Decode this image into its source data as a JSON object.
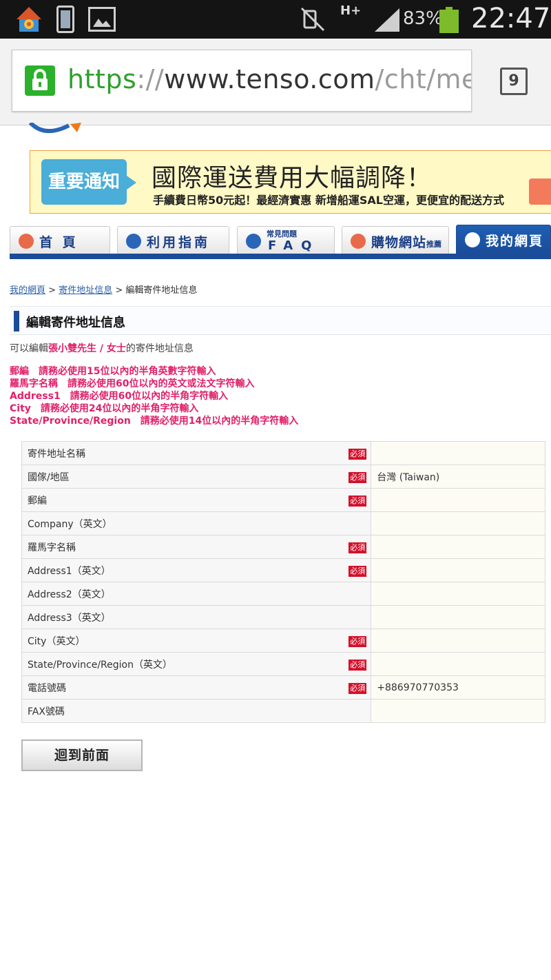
{
  "status_bar": {
    "network": "H+",
    "battery": "83%",
    "time": "22:47",
    "icons": [
      "home-app-icon",
      "phone-screen-icon",
      "gallery-icon",
      "mute-icon",
      "signal-icon",
      "battery-icon"
    ]
  },
  "browser": {
    "url_scheme": "https",
    "url_sep": "://",
    "url_host": "www.tenso.com",
    "url_path": "/cht/mem",
    "tab_count": "9"
  },
  "banner": {
    "tag": "重要通知",
    "title": "國際運送費用大幅調降！",
    "subtitle": "手續費日幣50元起！最經濟實惠  新增船運SAL空運，更便宜的配送方式"
  },
  "nav": {
    "home": "首 頁",
    "guide": "利用指南",
    "faq_small": "常見問題",
    "faq": "FAQ",
    "shopping": "購物網站",
    "shopping_small": "推薦",
    "mypage": "我的網頁"
  },
  "breadcrumb": {
    "crumb1": "我的網頁",
    "sep1": " > ",
    "crumb2": "寄件地址信息",
    "sep2": " > ",
    "current": "編輯寄件地址信息"
  },
  "page": {
    "title": "編輯寄件地址信息",
    "intro_prefix": "可以編輯",
    "intro_name": "張小雙先生 / 女士",
    "intro_suffix": "的寄件地址信息"
  },
  "rules": [
    "郵編　請務必使用15位以內的半角英數字符輸入",
    "羅馬字名稱　請務必使用60位以內的英文或法文字符輸入",
    "Address1　請務必使用60位以內的半角字符輸入",
    "City　請務必使用24位以內的半角字符輸入",
    "State/Province/Region　請務必使用14位以內的半角字符輸入"
  ],
  "required_label": "必須",
  "form_rows": [
    {
      "label": "寄件地址名稱",
      "required": true,
      "value": ""
    },
    {
      "label": "國傢/地區",
      "required": true,
      "value": "台灣 (Taiwan)"
    },
    {
      "label": "郵編",
      "required": true,
      "value": ""
    },
    {
      "label": "Company（英文）",
      "required": false,
      "value": ""
    },
    {
      "label": "羅馬字名稱",
      "required": true,
      "value": ""
    },
    {
      "label": "Address1（英文）",
      "required": true,
      "value": ""
    },
    {
      "label": "Address2（英文）",
      "required": false,
      "value": ""
    },
    {
      "label": "Address3（英文）",
      "required": false,
      "value": ""
    },
    {
      "label": "City（英文）",
      "required": true,
      "value": ""
    },
    {
      "label": "State/Province/Region（英文）",
      "required": true,
      "value": ""
    },
    {
      "label": "電話號碼",
      "required": true,
      "value": "+886970770353"
    },
    {
      "label": "FAX號碼",
      "required": false,
      "value": ""
    }
  ],
  "back_button": "迴到前面"
}
